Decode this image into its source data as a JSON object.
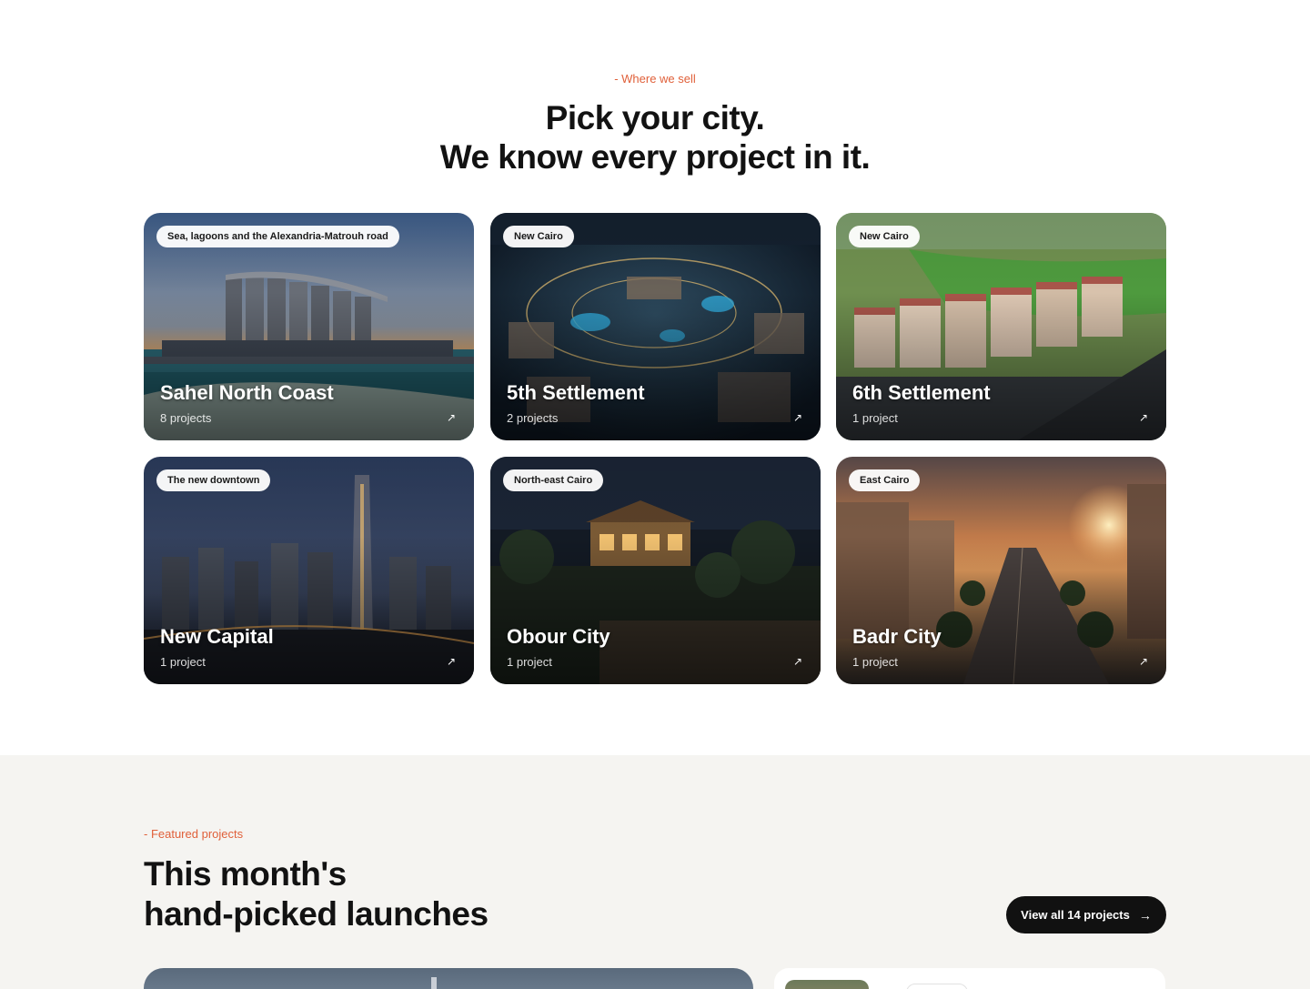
{
  "cities_section": {
    "eyebrow": "- Where we sell",
    "headline_line1": "Pick your city.",
    "headline_line2": "We know every project in it.",
    "cards": [
      {
        "tag": "Sea, lagoons and the Alexandria-Matrouh road",
        "title": "Sahel North Coast",
        "count": "8 projects",
        "arrow_icon": "arrow-up-right-icon"
      },
      {
        "tag": "New Cairo",
        "title": "5th Settlement",
        "count": "2 projects",
        "arrow_icon": "arrow-up-right-icon"
      },
      {
        "tag": "New Cairo",
        "title": "6th Settlement",
        "count": "1 project",
        "arrow_icon": "arrow-up-right-icon"
      },
      {
        "tag": "The new downtown",
        "title": "New Capital",
        "count": "1 project",
        "arrow_icon": "arrow-up-right-icon"
      },
      {
        "tag": "North-east Cairo",
        "title": "Obour City",
        "count": "1 project",
        "arrow_icon": "arrow-up-right-icon"
      },
      {
        "tag": "East Cairo",
        "title": "Badr City",
        "count": "1 project",
        "arrow_icon": "arrow-up-right-icon"
      }
    ]
  },
  "featured_section": {
    "eyebrow": "- Featured projects",
    "title_line1": "This month's",
    "title_line2": "hand-picked launches",
    "view_all_label": "View all 14 projects",
    "view_all_icon": "arrow-right-icon"
  },
  "colors": {
    "accent": "#e0603a",
    "dark": "#111111",
    "section_bg": "#f5f4f1"
  }
}
